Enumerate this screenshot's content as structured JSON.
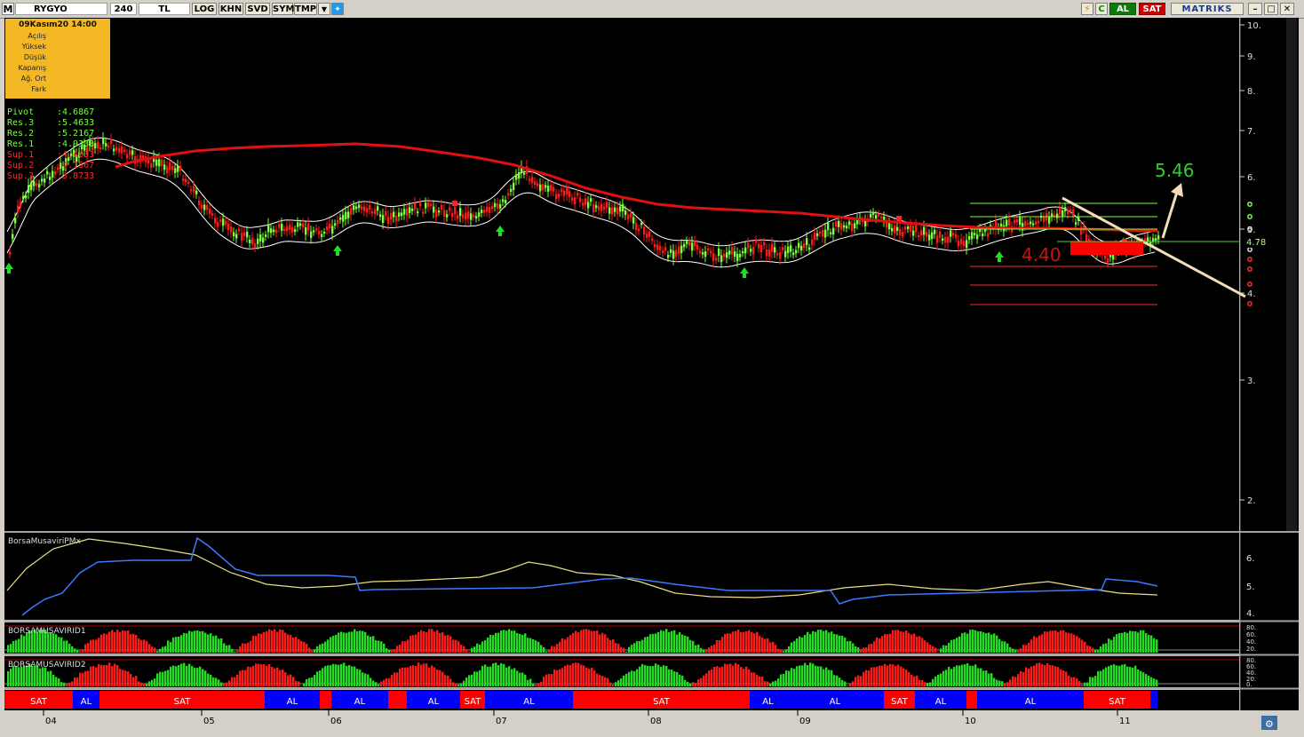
{
  "toolbar": {
    "app_icon": "M",
    "symbol": "RYGYO",
    "period": "240",
    "currency": "TL",
    "buttons": [
      "LOG",
      "KHN",
      "SVD",
      "SYM",
      "TMP"
    ],
    "al_label": "AL",
    "sat_label": "SAT",
    "brand": "MATRIKS",
    "refresh_label": "C",
    "icons": [
      "lightning-icon",
      "refresh-icon",
      "dropdown-icon",
      "twitter-icon",
      "minimize-icon",
      "maximize-icon",
      "close-icon"
    ]
  },
  "info_box": {
    "date": "09Kasım20 14:00",
    "rows": [
      "Açılış",
      "Yüksek",
      "Düşük",
      "Kapanış",
      "Ağ. Ort",
      "Fark"
    ]
  },
  "pivot": {
    "rows": [
      {
        "label": "Pivot",
        "value": ":4.6867",
        "color": "#7cff3a"
      },
      {
        "label": "Res.3",
        "value": ":5.4633",
        "color": "#7cff3a"
      },
      {
        "label": "Res.2",
        "value": ":5.2167",
        "color": "#7cff3a"
      },
      {
        "label": "Res.1",
        "value": ":4.9333",
        "color": "#7cff3a"
      },
      {
        "label": "Sup.1",
        "value": ":4.4033",
        "color": "#ff2a2a"
      },
      {
        "label": "Sup.2",
        "value": ":4.1567",
        "color": "#ff2a2a"
      },
      {
        "label": "Sup.3",
        "value": ":3.8733",
        "color": "#ff2a2a"
      }
    ]
  },
  "annotations": {
    "target": "5.46",
    "support": "4.40",
    "last_price": "4.78"
  },
  "price_axis": {
    "ticks": [
      "10.",
      "9.",
      "8.",
      "7.",
      "6.",
      "5.",
      "4.",
      "3.",
      "2."
    ]
  },
  "panels": {
    "pmx_title": "BorsaMusaviriPMx",
    "pmx_ticks": [
      "6.",
      "5.",
      "4."
    ],
    "d1_title": "BORSAMUSAVIRID1",
    "d1_ticks": [
      "80.",
      "60.",
      "40.",
      "20."
    ],
    "d2_title": "BORSAMUSAVIRID2",
    "d2_ticks": [
      "80.",
      "60.",
      "40.",
      "20.",
      "0."
    ]
  },
  "signals": {
    "segments": [
      {
        "label": "SAT",
        "color": "#ff0000"
      },
      {
        "label": "AL",
        "color": "#0000ff"
      },
      {
        "label": "SAT",
        "color": "#ff0000"
      },
      {
        "label": "AL",
        "color": "#0000ff"
      },
      {
        "label": "",
        "color": "#ff0000"
      },
      {
        "label": "AL",
        "color": "#0000ff"
      },
      {
        "label": "",
        "color": "#ff0000"
      },
      {
        "label": "AL",
        "color": "#0000ff"
      },
      {
        "label": "SAT",
        "color": "#ff0000"
      },
      {
        "label": "AL",
        "color": "#0000ff"
      },
      {
        "label": "SAT",
        "color": "#ff0000"
      },
      {
        "label": "AL",
        "color": "#0000ff"
      },
      {
        "label": "AL",
        "color": "#0000ff"
      },
      {
        "label": "SAT",
        "color": "#ff0000"
      },
      {
        "label": "AL",
        "color": "#0000ff"
      },
      {
        "label": "",
        "color": "#ff0000"
      },
      {
        "label": "AL",
        "color": "#0000ff"
      },
      {
        "label": "SAT",
        "color": "#ff0000"
      },
      {
        "label": "",
        "color": "#0000ff"
      }
    ]
  },
  "time_axis": {
    "labels": [
      "04",
      "05",
      "06",
      "07",
      "08",
      "09",
      "10",
      "11"
    ]
  },
  "colors": {
    "up": "#7cff3a",
    "down": "#ff1a1a",
    "ma": "#e01010",
    "band": "#ffffff",
    "accent_green": "#33cc33",
    "al": "#0000ff",
    "sat": "#ff0000"
  }
}
